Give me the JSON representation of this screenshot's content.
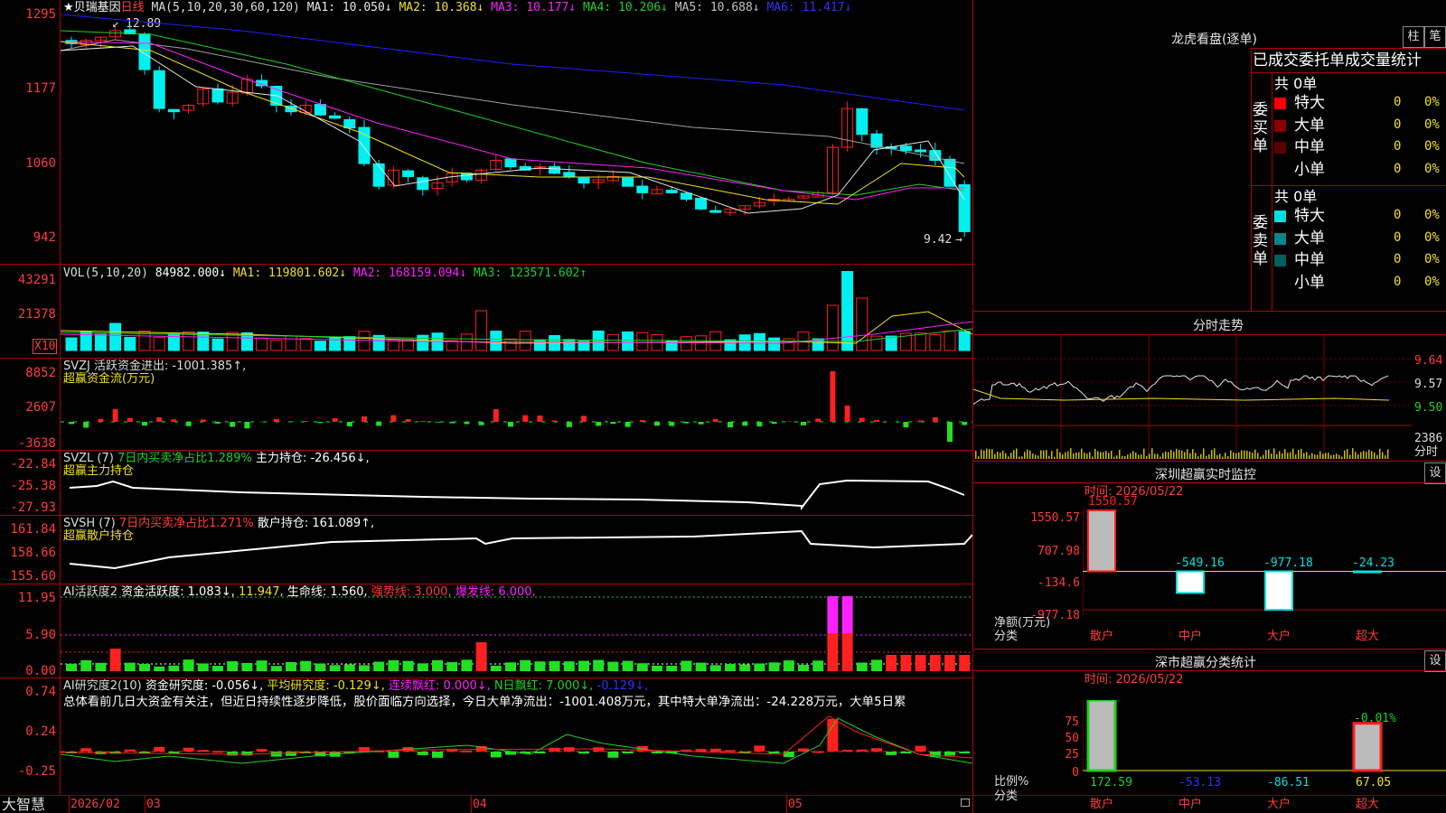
{
  "colors": {
    "up": "#ff2020",
    "down": "#00f0f0",
    "grid": "#b00000",
    "ma1": "#e6e6e6",
    "ma2": "#f0e020",
    "ma3": "#ff20ff",
    "ma4": "#20d020",
    "ma5": "#a0a0a0",
    "ma6": "#2020ff"
  },
  "kline": {
    "name": "★贝瑞基因",
    "period": "日线",
    "ma_label": "MA(5,10,20,30,60,120)",
    "ma1": "MA1: 10.050↓",
    "ma2": "MA2: 10.368↓",
    "ma3": "MA3: 10.177↓",
    "ma4": "MA4: 10.206↓",
    "ma5": "MA5: 10.688↓",
    "ma6": "MA6: 11.417↓",
    "y_ticks": [
      "1295",
      "1177",
      "1060",
      "942"
    ],
    "high_note": "12.89",
    "low_note": "9.42"
  },
  "vol": {
    "label": "VOL(5,10,20)",
    "value": "84982.000↓",
    "ma1": "MA1: 119801.602↓",
    "ma2": "MA2: 168159.094↓",
    "ma3": "MA3: 123571.602↑",
    "y_ticks": [
      "43291",
      "21378"
    ],
    "unit": "X10"
  },
  "svzj": {
    "label": "SVZJ  活跃资金进出: -1001.385↑,",
    "sub": "超赢资金流(万元)",
    "y_ticks": [
      "8852",
      "2607",
      "-3638"
    ]
  },
  "svzl": {
    "label": "SVZL (7)",
    "l2": "7日内买卖净占比1.289%",
    "l3": "主力持仓: -26.456↓,",
    "sub": "超赢主力持仓",
    "y_ticks": [
      "-22.84",
      "-25.38",
      "-27.93"
    ]
  },
  "svsh": {
    "label": "SVSH (7)",
    "l2": "7日内买卖净占比1.271%",
    "l3": "散户持仓: 161.089↑,",
    "sub": "超赢散户持仓",
    "y_ticks": [
      "161.84",
      "158.66",
      "155.60"
    ]
  },
  "ai1": {
    "label": "AI活跃度2",
    "l2": "资金活跃度: 1.083↓,",
    "l3": "11.947,",
    "l4": "生命线: 1.560,",
    "l5": "强势线: 3.000,",
    "l6": "爆发线: 6.000,",
    "y_ticks": [
      "11.95",
      "5.90",
      "0.00"
    ]
  },
  "ai2": {
    "label": "AI研究度2(10)",
    "l2": "资金研究度: -0.056↓,",
    "l3": "平均研究度: -0.129↓,",
    "l4": "连续飘红: 0.000↓,",
    "l5": "N日飘红: 7.000↓,",
    "l6": "-0.129↓,",
    "desc": "总体看前几日大资金有关注，但近日持续性逐步降低，股价面临方向选择，今日大单净流出：-1001.408万元，其中特大单净流出：-24.228万元，大单5日累",
    "y_ticks": [
      "0.74",
      "0.24",
      "-0.25"
    ]
  },
  "xaxis": {
    "logo": "大智慧",
    "labels": [
      "2026/02",
      "03",
      "04",
      "05"
    ]
  },
  "lhb": {
    "title": "龙虎看盘(逐单)",
    "btn1": "柱",
    "btn2": "笔",
    "header": "已成交委托单成交量统计",
    "buy_label": "委买单",
    "sell_label": "委卖单",
    "buy_total": "共 0单",
    "sell_total": "共 0单",
    "rows": [
      {
        "name": "特大",
        "v": "0",
        "p": "0%"
      },
      {
        "name": "大单",
        "v": "0",
        "p": "0%"
      },
      {
        "name": "中单",
        "v": "0",
        "p": "0%"
      },
      {
        "name": "小单",
        "v": "0",
        "p": "0%"
      }
    ]
  },
  "fenshi": {
    "title": "分时走势",
    "y_ticks": [
      "9.64",
      "9.57",
      "9.50"
    ],
    "vol": "2386",
    "vol_unit": "分时"
  },
  "monitor": {
    "title": "深圳超赢实时监控",
    "btn": "设",
    "date": "时间: 2026/05/22",
    "y_ticks": [
      "1550.57",
      "707.98",
      "-134.6",
      "-977.18"
    ],
    "ylabel": "净额(万元)",
    "xlabel": "分类",
    "cats": [
      "散户",
      "中户",
      "大户",
      "超大"
    ],
    "values": [
      "1550.57",
      "-549.16",
      "-977.18",
      "-24.23"
    ],
    "nums": [
      1550.57,
      -549.16,
      -977.18,
      -24.23
    ]
  },
  "classify": {
    "title": "深市超赢分类统计",
    "btn": "设",
    "date": "时间: 2026/05/22",
    "y_ticks": [
      "75",
      "50",
      "25",
      "0"
    ],
    "ylabel": "比例%",
    "xlabel": "分类",
    "cats": [
      "散户",
      "中户",
      "大户",
      "超大"
    ],
    "bottom": [
      "172.59",
      "-53.13",
      "-86.51",
      "67.05"
    ],
    "top_note": "-0.01%",
    "nums": [
      100,
      0,
      0,
      67
    ]
  }
}
